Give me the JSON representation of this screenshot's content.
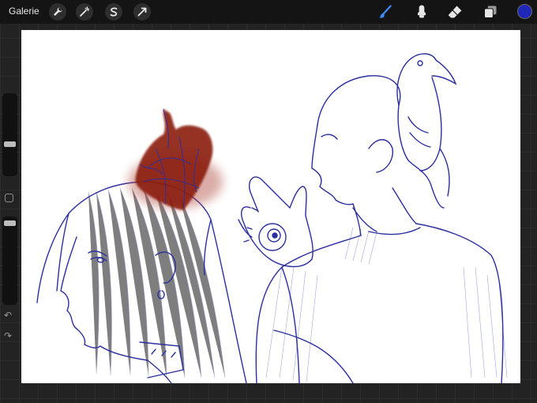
{
  "topbar": {
    "gallery_label": "Galerie",
    "left_tools": [
      "wrench-icon",
      "magic-wand-icon",
      "selection-s-icon",
      "transform-arrow-icon"
    ],
    "right_tools": [
      "brush-icon",
      "smudge-icon",
      "eraser-icon",
      "layers-icon"
    ],
    "active_tool": "brush-icon",
    "brush_color": "#1f26b8",
    "accent_color": "#3d8bff"
  },
  "sidebar": {
    "size_slider_level": 0.45,
    "opacity_slider_level": 0.05,
    "modify_button": "square-icon",
    "undo": "↶",
    "redo": "↷"
  },
  "canvas": {
    "background": "#ffffff",
    "ink_color": "#2b2f9e",
    "paint_color": "#8a1a0e"
  }
}
